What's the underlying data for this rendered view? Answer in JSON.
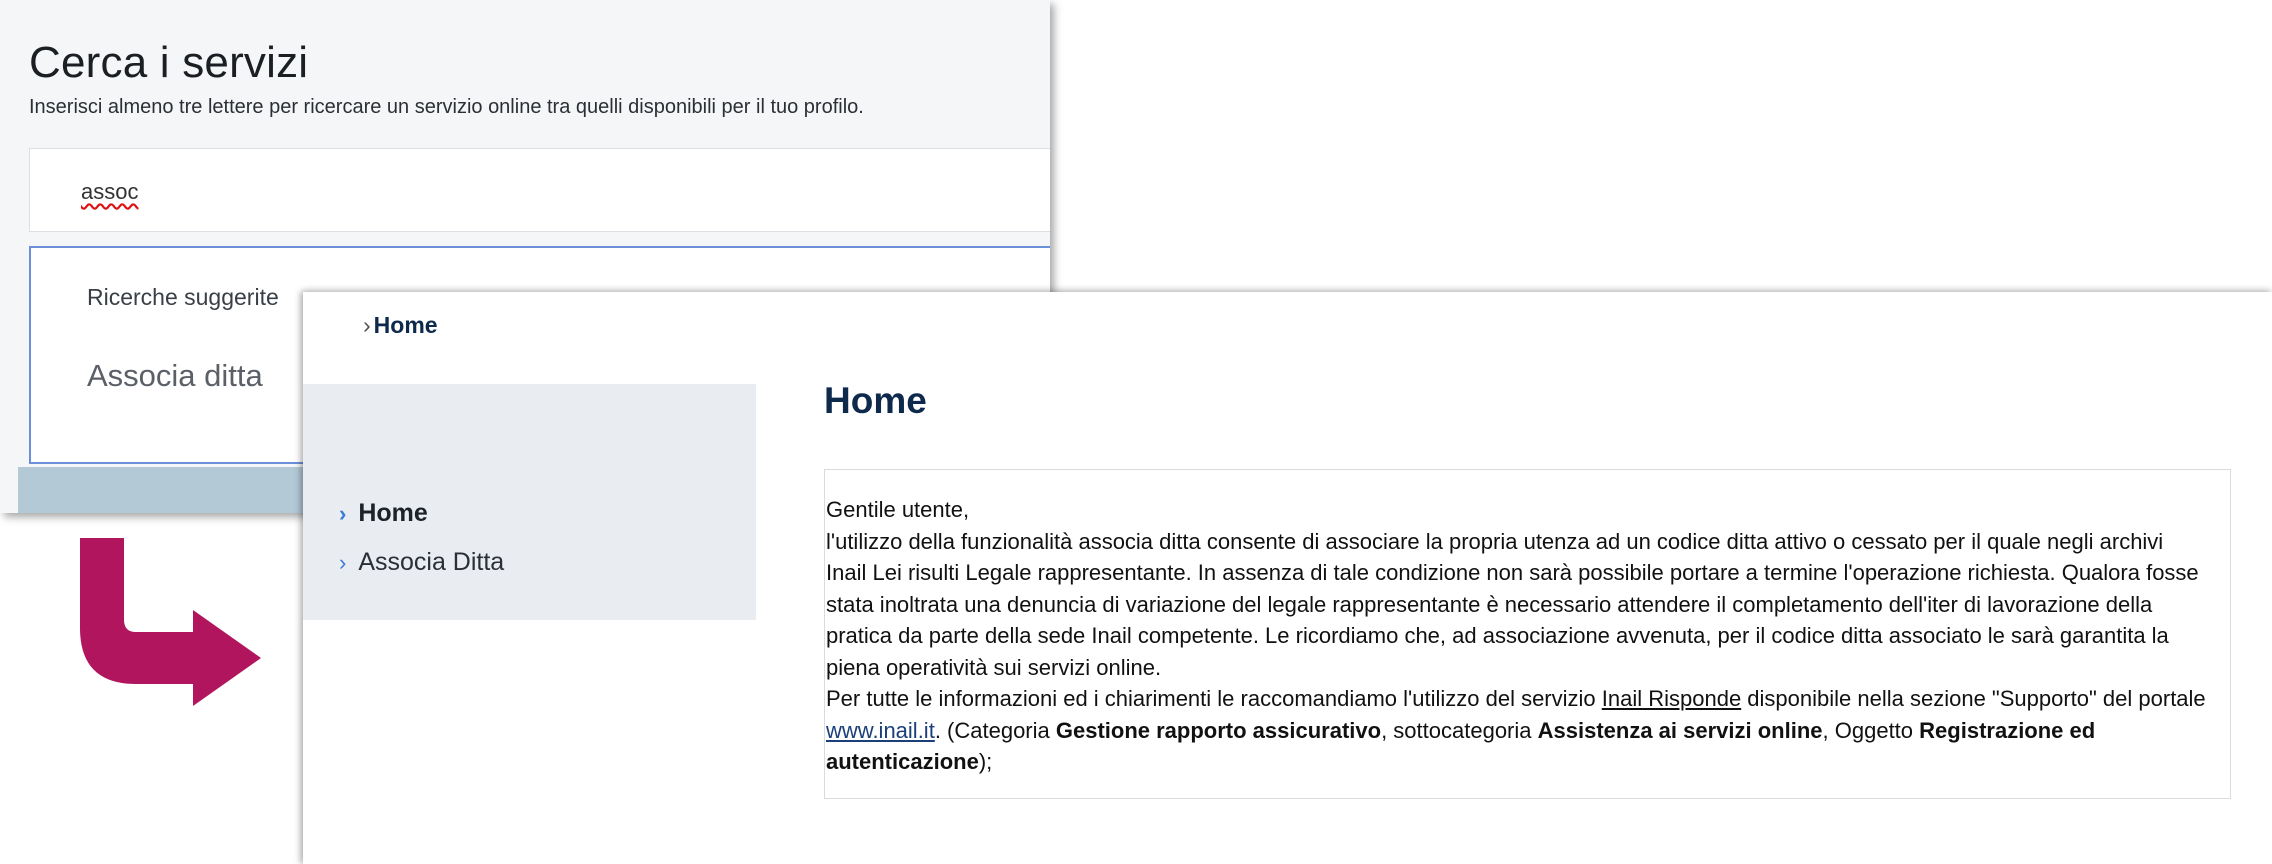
{
  "search": {
    "title": "Cerca i servizi",
    "subtitle": "Inserisci almeno tre lettere per ricercare un servizio online tra quelli disponibili per il tuo profilo.",
    "input_value": "assoc",
    "suggestions_label": "Ricerche suggerite",
    "suggestions": [
      "Associa ditta"
    ]
  },
  "arrow": {
    "color": "#b0155d"
  },
  "home": {
    "breadcrumb": "Home",
    "menu": [
      {
        "label": "Home",
        "active": true
      },
      {
        "label": "Associa Ditta",
        "active": false
      }
    ],
    "title": "Home",
    "body": {
      "greeting": "Gentile utente,",
      "paragraph1": "l'utilizzo della funzionalità associa ditta consente di associare la propria utenza ad un codice ditta attivo o cessato per il quale negli archivi Inail Lei risulti Legale rappresentante. In assenza di tale condizione non sarà possibile portare a termine l'operazione richiesta. Qualora fosse stata inoltrata una denuncia di variazione del legale rappresentante è necessario attendere il completamento dell'iter di lavorazione della pratica da parte della sede Inail competente. Le ricordiamo che, ad associazione avvenuta, per il codice ditta associato le sarà garantita la piena operatività sui servizi online.",
      "p2_prefix": "Per tutte le informazioni ed i chiarimenti le raccomandiamo l'utilizzo del servizio ",
      "link_risponde": "Inail Risponde",
      "p2_mid1": " disponibile nella sezione \"Supporto\" del portale ",
      "link_site": "www.inail.it",
      "p2_mid2": ". (Categoria ",
      "bold_categoria": "Gestione rapporto assicurativo",
      "p2_mid3": ", sottocategoria ",
      "bold_sottocategoria": "Assistenza ai servizi online",
      "p2_mid4": ", Oggetto ",
      "bold_oggetto": "Registrazione ed autenticazione",
      "p2_end": ");"
    }
  }
}
